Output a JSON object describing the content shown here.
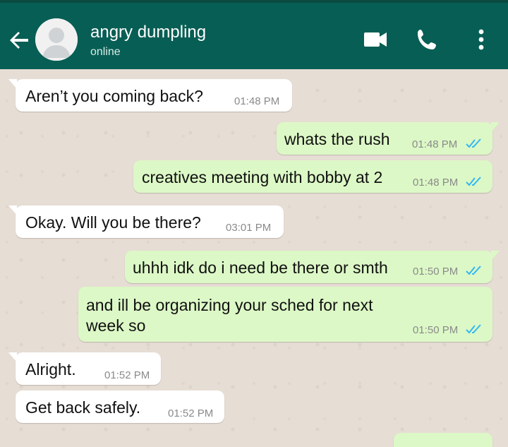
{
  "header": {
    "contact_name": "angry dumpling",
    "status": "online",
    "icons": [
      "back-arrow-icon",
      "avatar-placeholder-icon",
      "video-call-icon",
      "phone-icon",
      "more-vert-icon"
    ]
  },
  "colors": {
    "header": "#075e54",
    "outgoing_bubble": "#dcf8c6",
    "incoming_bubble": "#ffffff",
    "read_ticks": "#34b7f1",
    "wallpaper": "#e6ddd4"
  },
  "messages": [
    {
      "direction": "in",
      "text": "Aren’t you coming back?",
      "time": "01:48 PM"
    },
    {
      "direction": "out",
      "text": "whats the rush",
      "time": "01:48 PM",
      "read": true
    },
    {
      "direction": "out",
      "text": "creatives meeting with bobby at 2",
      "time": "01:48 PM",
      "read": true
    },
    {
      "direction": "in",
      "text": "Okay. Will you be there?",
      "time": "03:01 PM"
    },
    {
      "direction": "out",
      "text": "uhhh idk do i need be there or smth",
      "time": "01:50 PM",
      "read": true
    },
    {
      "direction": "out",
      "text_line1": "and ill be organizing your sched for next",
      "text_line2": "week so",
      "time": "01:50 PM",
      "read": true
    },
    {
      "direction": "in",
      "text": "Alright.",
      "time": "01:52 PM"
    },
    {
      "direction": "in",
      "text": "Get back safely.",
      "time": "01:52 PM"
    }
  ]
}
